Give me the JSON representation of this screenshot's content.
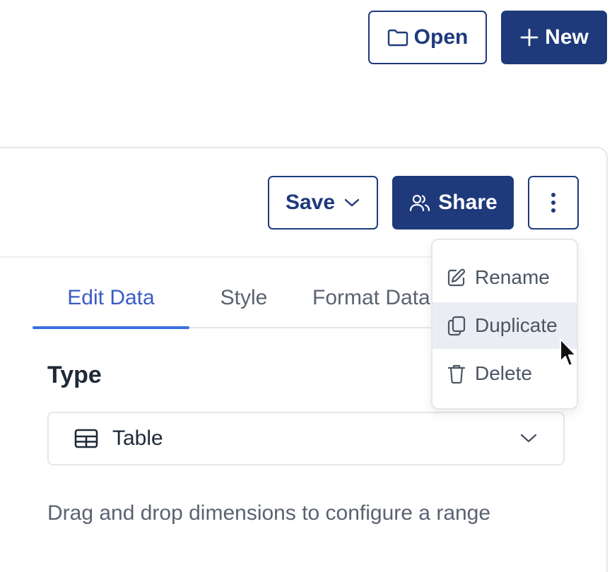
{
  "header": {
    "open_label": "Open",
    "new_label": "New"
  },
  "toolbar": {
    "save_label": "Save",
    "share_label": "Share"
  },
  "tabs": [
    {
      "label": "Edit Data",
      "active": true
    },
    {
      "label": "Style",
      "active": false
    },
    {
      "label": "Format Data",
      "active": false
    }
  ],
  "editor": {
    "type_label": "Type",
    "type_select": {
      "value": "Table"
    },
    "helper_text": "Drag and drop dimensions to configure a range"
  },
  "more_menu": {
    "items": [
      {
        "label": "Rename",
        "icon": "pencil-icon"
      },
      {
        "label": "Duplicate",
        "icon": "copy-icon",
        "hovered": true
      },
      {
        "label": "Delete",
        "icon": "trash-icon"
      }
    ]
  },
  "colors": {
    "primary": "#1e3a7b",
    "accent_tab": "#3b5cc4",
    "menu_hover": "#eaedf3",
    "border": "#e5e7eb"
  }
}
